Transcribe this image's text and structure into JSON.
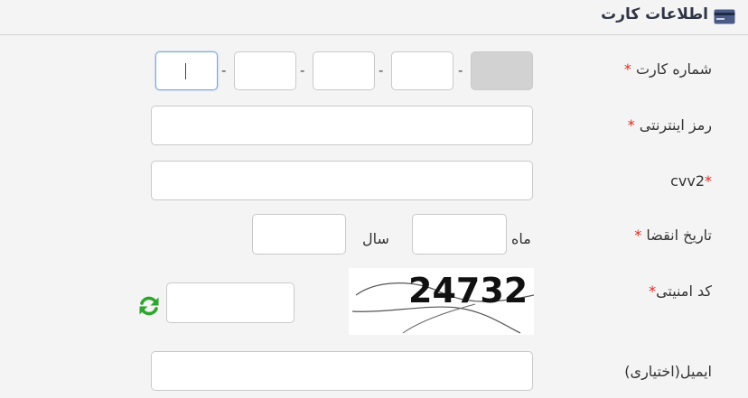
{
  "header": {
    "title": "اطلاعات کارت",
    "icon": "credit-card-icon"
  },
  "card_number": {
    "label": "شماره کارت",
    "required_mark": "*",
    "separator": "-",
    "segments": [
      "",
      "",
      "",
      "",
      ""
    ]
  },
  "password": {
    "label": "رمز اینترنتی",
    "required_mark": "*",
    "value": ""
  },
  "cvv2": {
    "label": "cvv2",
    "required_mark": "*",
    "value": ""
  },
  "expiry": {
    "label": "تاریخ انقضا",
    "required_mark": "*",
    "month_label": "ماه",
    "year_label": "سال",
    "month_value": "",
    "year_value": ""
  },
  "captcha": {
    "label": "کد امنیتی",
    "required_mark": "*",
    "code": "24732",
    "value": "",
    "refresh_icon": "refresh-icon"
  },
  "email": {
    "label": "ایمیل(اختیاری)",
    "value": ""
  },
  "colors": {
    "required": "#e0271c",
    "refresh": "#2ea52e",
    "header_text": "#2f3546",
    "icon_blue": "#4a5b86"
  }
}
